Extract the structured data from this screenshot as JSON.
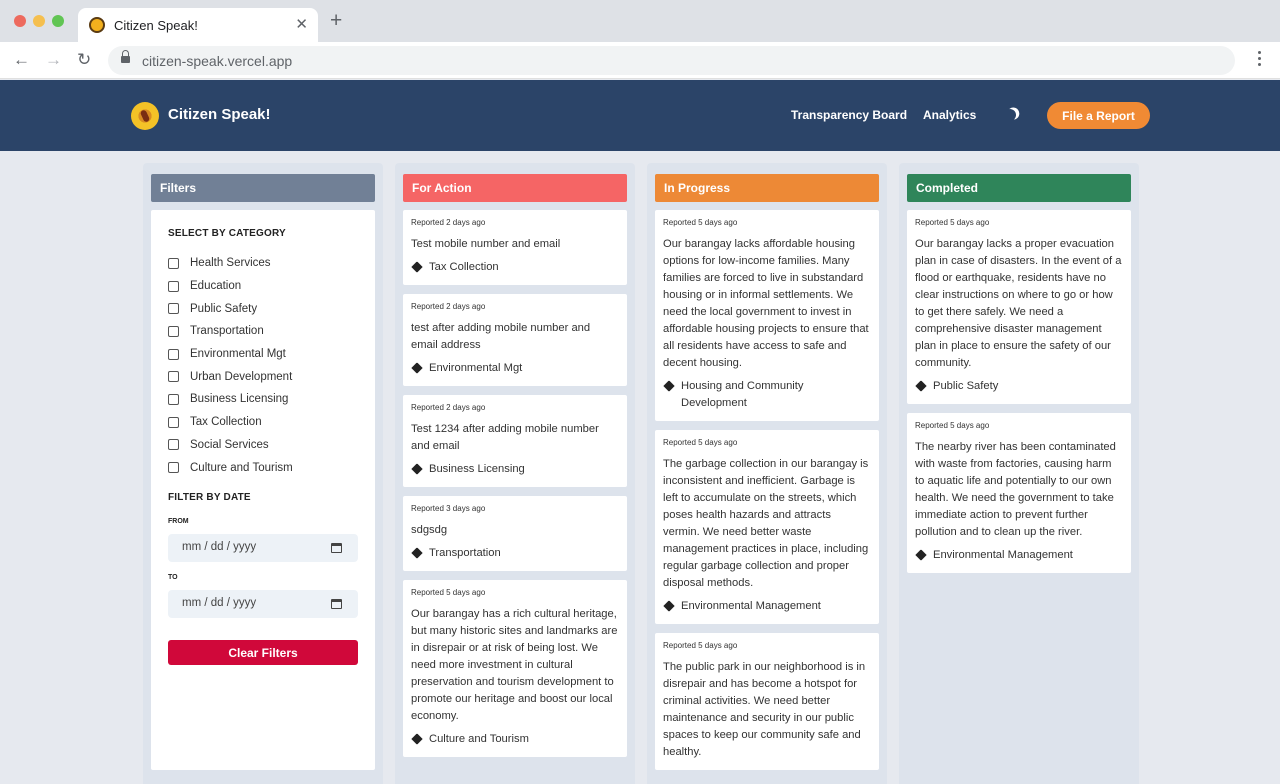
{
  "browser": {
    "tab_title": "Citizen Speak!",
    "tab_close": "✕",
    "new_tab": "+",
    "url": "citizen-speak.vercel.app"
  },
  "header": {
    "brand": "Citizen Speak!",
    "nav": [
      "Transparency Board",
      "Analytics"
    ],
    "file_report": "File a Report"
  },
  "filters": {
    "title": "Filters",
    "category_heading": "SELECT BY CATEGORY",
    "categories": [
      "Health Services",
      "Education",
      "Public Safety",
      "Transportation",
      "Environmental Mgt",
      "Urban Development",
      "Business Licensing",
      "Tax Collection",
      "Social Services",
      "Culture and Tourism"
    ],
    "date_heading": "FILTER BY DATE",
    "from_label": "FROM",
    "to_label": "TO",
    "date_placeholder": "mm / dd / yyyy",
    "clear_button": "Clear Filters"
  },
  "columns": {
    "for_action": {
      "title": "For Action",
      "cards": [
        {
          "meta": "Reported 2 days ago",
          "text": "Test mobile number and email",
          "tag": "Tax Collection"
        },
        {
          "meta": "Reported 2 days ago",
          "text": "test after adding mobile number and email address",
          "tag": "Environmental Mgt"
        },
        {
          "meta": "Reported 2 days ago",
          "text": "Test 1234 after adding mobile number and email",
          "tag": "Business Licensing"
        },
        {
          "meta": "Reported 3 days ago",
          "text": "sdgsdg",
          "tag": "Transportation"
        },
        {
          "meta": "Reported 5 days ago",
          "text": "Our barangay has a rich cultural heritage, but many historic sites and landmarks are in disrepair or at risk of being lost. We need more investment in cultural preservation and tourism development to promote our heritage and boost our local economy.",
          "tag": "Culture and Tourism"
        }
      ]
    },
    "in_progress": {
      "title": "In Progress",
      "cards": [
        {
          "meta": "Reported 5 days ago",
          "text": "Our barangay lacks affordable housing options for low-income families. Many families are forced to live in substandard housing or in informal settlements. We need the local government to invest in affordable housing projects to ensure that all residents have access to safe and decent housing.",
          "tag": "Housing and Community Development"
        },
        {
          "meta": "Reported 5 days ago",
          "text": "The garbage collection in our barangay is inconsistent and inefficient. Garbage is left to accumulate on the streets, which poses health hazards and attracts vermin. We need better waste management practices in place, including regular garbage collection and proper disposal methods.",
          "tag": "Environmental Management"
        },
        {
          "meta": "Reported 5 days ago",
          "text": "The public park in our neighborhood is in disrepair and has become a hotspot for criminal activities. We need better maintenance and security in our public spaces to keep our community safe and healthy.",
          "tag": ""
        }
      ]
    },
    "completed": {
      "title": "Completed",
      "cards": [
        {
          "meta": "Reported 5 days ago",
          "text": "Our barangay lacks a proper evacuation plan in case of disasters. In the event of a flood or earthquake, residents have no clear instructions on where to go or how to get there safely. We need a comprehensive disaster management plan in place to ensure the safety of our community.",
          "tag": "Public Safety"
        },
        {
          "meta": "Reported 5 days ago",
          "text": "The nearby river has been contaminated with waste from factories, causing harm to aquatic life and potentially to our own health. We need the government to take immediate action to prevent further pollution and to clean up the river.",
          "tag": "Environmental Management"
        }
      ]
    }
  }
}
